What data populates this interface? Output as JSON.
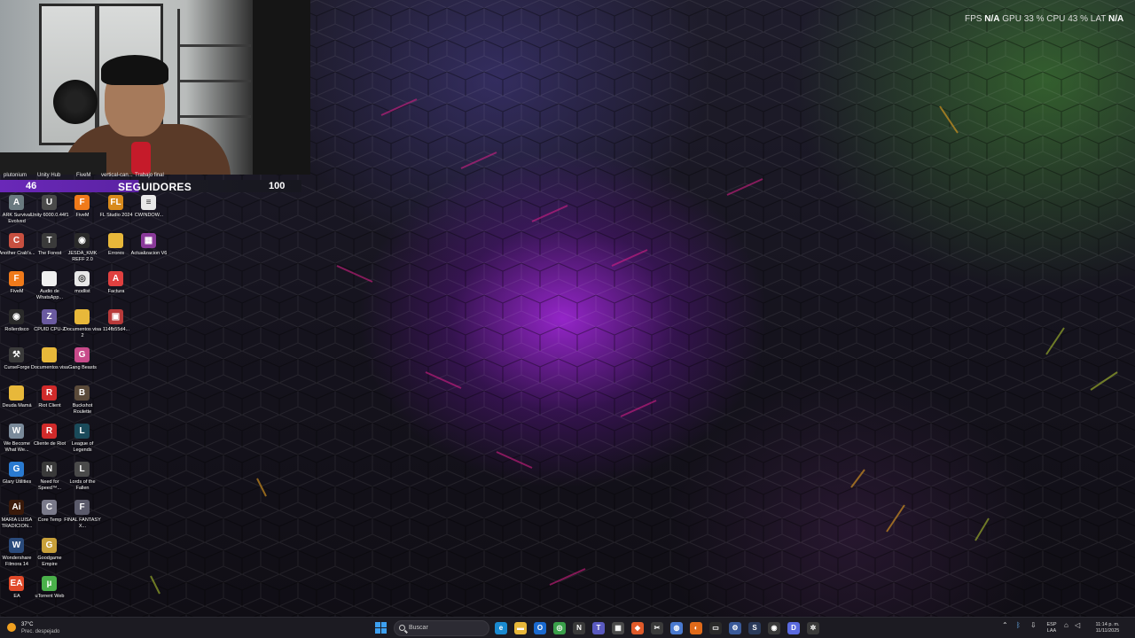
{
  "webcam": {
    "bottom_labels": [
      "plutonium",
      "Unity Hub",
      "FiveM",
      "vertical-can...",
      "Trabajo final"
    ]
  },
  "follower_goal": {
    "current": "46",
    "label": "SEGUIDORES",
    "target": "100",
    "progress_fraction": 0.46,
    "fill_color": "#6a28b8"
  },
  "performance_overlay": {
    "fps_label": "FPS",
    "fps_value": "N/A",
    "gpu_label": "GPU",
    "gpu_value": "33 %",
    "cpu_label": "CPU",
    "cpu_value": "43 %",
    "lat_label": "LAT",
    "lat_value": "N/A"
  },
  "desktop": {
    "icons": [
      {
        "label": "ARK Survival Evolved",
        "icon": "ark-icon",
        "color": "#6a7a80",
        "glyph": "A"
      },
      {
        "label": "Unity 6000.0.44f1",
        "icon": "unity-icon",
        "color": "#4a4a4a",
        "glyph": "U"
      },
      {
        "label": "FiveM",
        "icon": "fivem-icon",
        "color": "#f07a1a",
        "glyph": "F"
      },
      {
        "label": "FL Studio 2024",
        "icon": "fl-studio-icon",
        "color": "#d88a1c",
        "glyph": "FL"
      },
      {
        "label": "CWINDOW...",
        "icon": "document-icon",
        "color": "#e8e8e8",
        "glyph": "≡"
      },
      {
        "label": "Another Crab's...",
        "icon": "crab-game-icon",
        "color": "#c85040",
        "glyph": "C"
      },
      {
        "label": "The Forest",
        "icon": "forest-game-icon",
        "color": "#3a3a3a",
        "glyph": "T"
      },
      {
        "label": "JESDA_KMK REFF 2.0",
        "icon": "app-icon",
        "color": "#2a2a2a",
        "glyph": "◉"
      },
      {
        "label": "Errores",
        "icon": "folder-icon",
        "color": "#e8b83a",
        "glyph": ""
      },
      {
        "label": "Actualizacion V6",
        "icon": "archive-icon",
        "color": "#8a3a9a",
        "glyph": "▦"
      },
      {
        "label": "FiveM",
        "icon": "fivem-icon",
        "color": "#f07a1a",
        "glyph": "F"
      },
      {
        "label": "Audio de WhatsApp...",
        "icon": "file-icon",
        "color": "#f0f0f0",
        "glyph": ""
      },
      {
        "label": "modlist",
        "icon": "chrome-file-icon",
        "color": "#e8e8e8",
        "glyph": "◎"
      },
      {
        "label": "Factura",
        "icon": "pdf-icon",
        "color": "#e04040",
        "glyph": "A"
      },
      {
        "label": "Rollerdisco",
        "icon": "app-icon",
        "color": "#2a2a2a",
        "glyph": "◉"
      },
      {
        "label": "CPUID CPU-Z",
        "icon": "cpuz-icon",
        "color": "#6a5aa0",
        "glyph": "Z"
      },
      {
        "label": "Documentos visa 2",
        "icon": "folder-icon",
        "color": "#e8b83a",
        "glyph": ""
      },
      {
        "label": "114fb55d4...",
        "icon": "image-icon",
        "color": "#b83a3a",
        "glyph": "▣"
      },
      {
        "label": "CurseForge",
        "icon": "curseforge-icon",
        "color": "#3a3a3a",
        "glyph": "⚒"
      },
      {
        "label": "Documentos visa",
        "icon": "folder-icon",
        "color": "#e8b83a",
        "glyph": ""
      },
      {
        "label": "Gang Beasts",
        "icon": "gang-beasts-icon",
        "color": "#c84a8a",
        "glyph": "G"
      },
      {
        "label": "Deuda Mamá",
        "icon": "folder-icon",
        "color": "#e8b83a",
        "glyph": ""
      },
      {
        "label": "Riot Client",
        "icon": "riot-icon",
        "color": "#d02a2a",
        "glyph": "R"
      },
      {
        "label": "Buckshot Roulette",
        "icon": "buckshot-icon",
        "color": "#5a4a3a",
        "glyph": "B"
      },
      {
        "label": "We Become What We...",
        "icon": "game-icon",
        "color": "#7a8a9a",
        "glyph": "W"
      },
      {
        "label": "Cliente de Riot",
        "icon": "riot-icon",
        "color": "#d02a2a",
        "glyph": "R"
      },
      {
        "label": "League of Legends",
        "icon": "lol-icon",
        "color": "#1a4a5a",
        "glyph": "L"
      },
      {
        "label": "Glary Utilities",
        "icon": "glary-icon",
        "color": "#2a7ad0",
        "glyph": "G"
      },
      {
        "label": "Need for Speed™...",
        "icon": "nfs-icon",
        "color": "#3a3a3a",
        "glyph": "N"
      },
      {
        "label": "Lords of the Fallen",
        "icon": "lotf-icon",
        "color": "#4a4a4a",
        "glyph": "L"
      },
      {
        "label": "MARIA LUISA TRADICION...",
        "icon": "illustrator-icon",
        "color": "#3a1a0a",
        "glyph": "Ai"
      },
      {
        "label": "Core Temp",
        "icon": "coretemp-icon",
        "color": "#7a7a8a",
        "glyph": "C"
      },
      {
        "label": "FINAL FANTASY X...",
        "icon": "ffx-icon",
        "color": "#5a5a6a",
        "glyph": "F"
      },
      {
        "label": "Wondershare Filmora 14",
        "icon": "filmora-icon",
        "color": "#2a4a7a",
        "glyph": "W"
      },
      {
        "label": "Goodgame Empire",
        "icon": "goodgame-icon",
        "color": "#c8a03a",
        "glyph": "G"
      },
      {
        "label": "EA",
        "icon": "ea-icon",
        "color": "#e04a2a",
        "glyph": "EA"
      },
      {
        "label": "uTorrent Web",
        "icon": "utorrent-icon",
        "color": "#4ab04a",
        "glyph": "µ"
      }
    ]
  },
  "taskbar": {
    "weather_temp": "37°C",
    "weather_condition": "Prec. despejado",
    "search_placeholder": "Buscar",
    "apps": [
      {
        "icon": "edge-icon",
        "color": "#1a8ad0",
        "glyph": "e"
      },
      {
        "icon": "file-explorer-icon",
        "color": "#e8b83a",
        "glyph": "▬"
      },
      {
        "icon": "outlook-icon",
        "color": "#1a6ad0",
        "glyph": "O"
      },
      {
        "icon": "chrome-icon",
        "color": "#3aa04a",
        "glyph": "◎"
      },
      {
        "icon": "notion-icon",
        "color": "#3a3a3a",
        "glyph": "N"
      },
      {
        "icon": "teams-icon",
        "color": "#5a5ac0",
        "glyph": "T"
      },
      {
        "icon": "calculator-icon",
        "color": "#4a4a4a",
        "glyph": "▦"
      },
      {
        "icon": "brave-icon",
        "color": "#e05a2a",
        "glyph": "◆"
      },
      {
        "icon": "capcut-icon",
        "color": "#3a3a3a",
        "glyph": "✂"
      },
      {
        "icon": "globe-icon",
        "color": "#4a7ad0",
        "glyph": "◍"
      },
      {
        "icon": "firefox-icon",
        "color": "#e06a1a",
        "glyph": "◐"
      },
      {
        "icon": "terminal-icon",
        "color": "#2a2a2a",
        "glyph": "▭"
      },
      {
        "icon": "settings-icon",
        "color": "#3a5a9a",
        "glyph": "⚙"
      },
      {
        "icon": "steam-icon",
        "color": "#2a3a5a",
        "glyph": "S"
      },
      {
        "icon": "obs-icon",
        "color": "#3a3a3a",
        "glyph": "◉"
      },
      {
        "icon": "discord-icon",
        "color": "#5a6ae0",
        "glyph": "D"
      },
      {
        "icon": "gear-icon",
        "color": "#3a3a3a",
        "glyph": "✲"
      }
    ],
    "tray": {
      "language_line1": "ESP",
      "language_line2": "LAA",
      "time": "11:14 p. m.",
      "date": "11/11/2025"
    }
  }
}
